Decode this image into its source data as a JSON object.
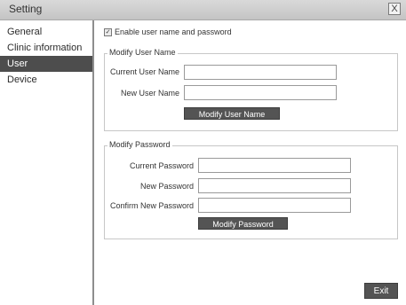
{
  "window": {
    "title": "Setting",
    "close_glyph": "X"
  },
  "sidebar": {
    "items": [
      {
        "label": "General"
      },
      {
        "label": "Clinic information"
      },
      {
        "label": "User"
      },
      {
        "label": "Device"
      }
    ],
    "active": "User"
  },
  "options": {
    "enable_label": "Enable user name and password",
    "enable_checked": true
  },
  "modify_user": {
    "legend": "Modify User Name",
    "current_label": "Current User Name",
    "current_value": "",
    "new_label": "New User Name",
    "new_value": "",
    "button": "Modify User Name"
  },
  "modify_password": {
    "legend": "Modify Password",
    "current_label": "Current Password",
    "current_value": "",
    "new_label": "New Password",
    "new_value": "",
    "confirm_label": "Confirm New Password",
    "confirm_value": "",
    "button": "Modify Password"
  },
  "footer": {
    "exit_label": "Exit"
  },
  "colors": {
    "sidebar_active_bg": "#4d4d4d",
    "button_bg": "#545454",
    "titlebar_bg": "#c4c4c4"
  },
  "icons": {
    "close": "close-icon",
    "checkbox": "check-icon"
  }
}
